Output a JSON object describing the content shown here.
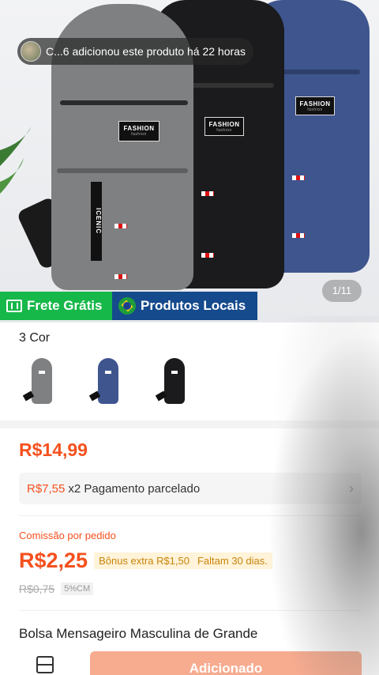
{
  "notification": {
    "text": "C...6 adicionou este produto há 22 horas"
  },
  "gallery": {
    "indicator": "1/11"
  },
  "badges": {
    "shipping": "Frete Grátis",
    "local": "Produtos Locais"
  },
  "product_image": {
    "label_text": "FASHION",
    "label_sub": "fashion",
    "strip_text": "ICENIC"
  },
  "variants": {
    "title": "3 Cor",
    "colors": [
      "gray",
      "blue",
      "black"
    ]
  },
  "price": {
    "current": "R$14,99",
    "installment_amount": "R$7,55",
    "installment_text": "x2 Pagamento parcelado"
  },
  "commission": {
    "label": "Comissão por pedido",
    "value": "R$2,25",
    "bonus": "Bônus extra R$1,50",
    "days_left": "Faltam 30 dias.",
    "old_value": "R$0,75",
    "percent": "5%CM"
  },
  "product": {
    "title": "Bolsa Mensageiro Masculina de Grande"
  },
  "bottom_bar": {
    "add_label": "Adicionado"
  },
  "colors": {
    "accent": "#f5501e",
    "ship_green": "#17b84a",
    "local_blue": "#154a8c",
    "button": "#f7ab8f"
  }
}
